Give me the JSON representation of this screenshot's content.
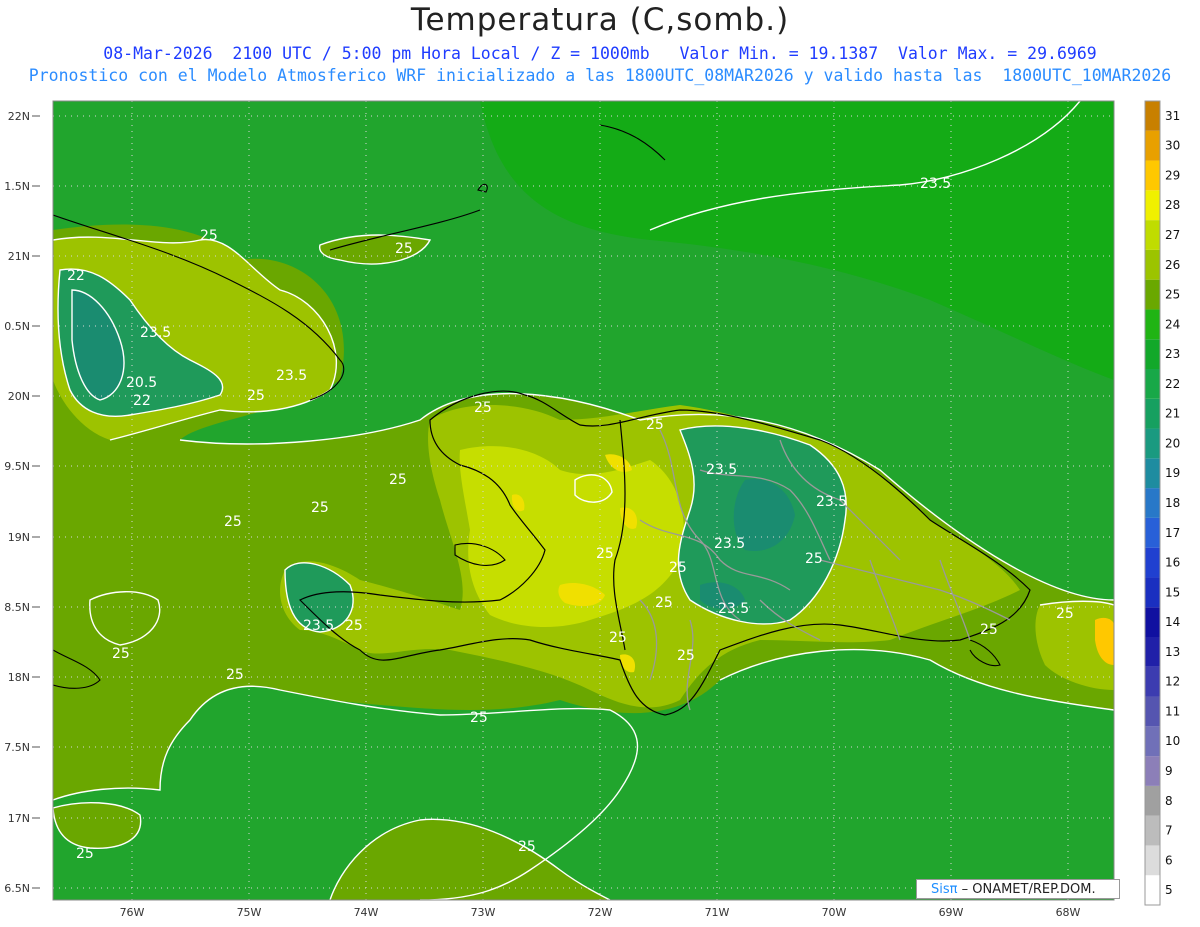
{
  "title": "Temperatura (C,somb.)",
  "subtitle_line1": "08-Mar-2026  2100 UTC / 5:00 pm Hora Local / Z = 1000mb   Valor Min. = 19.1387  Valor Max. = 29.6969",
  "subtitle_line2": "Pronostico con el Modelo Atmosferico WRF inicializado a las 1800UTC_08MAR2026 y valido hasta las  1800UTC_10MAR2026",
  "credit": {
    "logo": "Sisπ",
    "text": " – ONAMET/REP.DOM."
  },
  "lat_labels": [
    "22N",
    "1.5N",
    "21N",
    "0.5N",
    "20N",
    "9.5N",
    "19N",
    "8.5N",
    "18N",
    "7.5N",
    "17N",
    "6.5N"
  ],
  "lon_labels": [
    "76W",
    "75W",
    "74W",
    "73W",
    "72W",
    "71W",
    "70W",
    "69W",
    "68W"
  ],
  "colorbar": {
    "labels": [
      "5",
      "6",
      "7",
      "8",
      "9",
      "10",
      "11",
      "12",
      "13",
      "14",
      "15",
      "16",
      "17",
      "18",
      "19",
      "20",
      "21",
      "22",
      "23",
      "24",
      "25",
      "26",
      "27",
      "28",
      "29",
      "30",
      "31"
    ],
    "colors": [
      "#ffffff",
      "#dcdcdc",
      "#bcbcbc",
      "#a0a0a0",
      "#8c7fb8",
      "#7070b8",
      "#5555b0",
      "#3c3cb0",
      "#2020a8",
      "#1010a0",
      "#1a2fc0",
      "#2040d0",
      "#2860d8",
      "#2878c8",
      "#1e8ca0",
      "#1a9a80",
      "#16a060",
      "#18a848",
      "#12a82a",
      "#20b414",
      "#6aa800",
      "#9cc400",
      "#c0dc00",
      "#f0f000",
      "#ffc800",
      "#e8a000",
      "#c88000"
    ]
  },
  "contour_labels": [
    "25",
    "25",
    "22",
    "23.5",
    "20.5",
    "22",
    "23.5",
    "25",
    "25",
    "25",
    "25",
    "25",
    "25",
    "23.5",
    "23.5",
    "23.5",
    "25",
    "25",
    "25",
    "23.5",
    "25",
    "25",
    "23.5",
    "25",
    "25",
    "25",
    "25",
    "25",
    "25",
    "25",
    "25",
    "25",
    "23.5"
  ],
  "colors": {
    "ocean": "#21a52d",
    "ocean_north": "#14ab16",
    "land_base": "#6aa700",
    "land_warm": "#9dc300",
    "land_hot": "#c6de00",
    "land_peak": "#f0e000",
    "cool": "#1f9a5a",
    "cooler": "#1a8c70"
  }
}
